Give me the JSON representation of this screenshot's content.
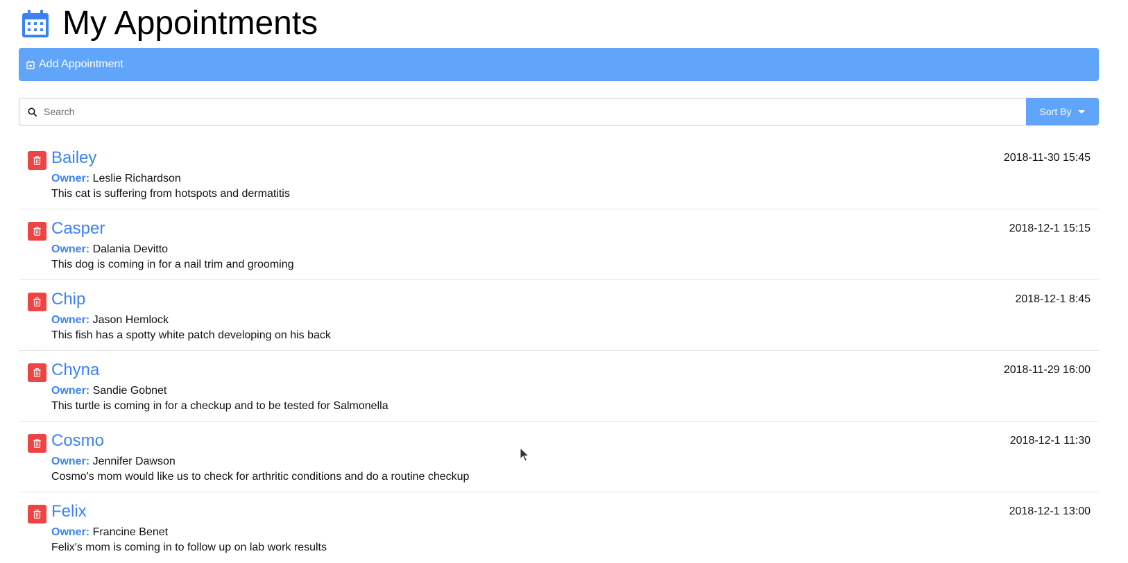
{
  "header": {
    "title": "My Appointments",
    "icon": "calendar-icon",
    "icon_color": "#3b82f6"
  },
  "add_appointment": {
    "label": "Add Appointment",
    "icon": "calendar-plus-icon",
    "color": "#60a5fa"
  },
  "search": {
    "placeholder": "Search",
    "value": "",
    "icon": "search-icon"
  },
  "sort": {
    "label": "Sort By",
    "icon": "caret-down-icon"
  },
  "labels": {
    "owner": "Owner:"
  },
  "colors": {
    "accent": "#3b82f6",
    "danger": "#ef4444",
    "bar": "#60a5fa"
  },
  "appointments": [
    {
      "pet": "Bailey",
      "owner": "Leslie Richardson",
      "notes": "This cat is suffering from hotspots and dermatitis",
      "date": "2018-11-30 15:45"
    },
    {
      "pet": "Casper",
      "owner": "Dalania Devitto",
      "notes": "This dog is coming in for a nail trim and grooming",
      "date": "2018-12-1 15:15"
    },
    {
      "pet": "Chip",
      "owner": "Jason Hemlock",
      "notes": "This fish has a spotty white patch developing on his back",
      "date": "2018-12-1 8:45"
    },
    {
      "pet": "Chyna",
      "owner": "Sandie Gobnet",
      "notes": "This turtle is coming in for a checkup and to be tested for Salmonella",
      "date": "2018-11-29 16:00"
    },
    {
      "pet": "Cosmo",
      "owner": "Jennifer Dawson",
      "notes": "Cosmo's mom would like us to check for arthritic conditions and do a routine checkup",
      "date": "2018-12-1 11:30"
    },
    {
      "pet": "Felix",
      "owner": "Francine Benet",
      "notes": "Felix's mom is coming in to follow up on lab work results",
      "date": "2018-12-1 13:00"
    }
  ]
}
